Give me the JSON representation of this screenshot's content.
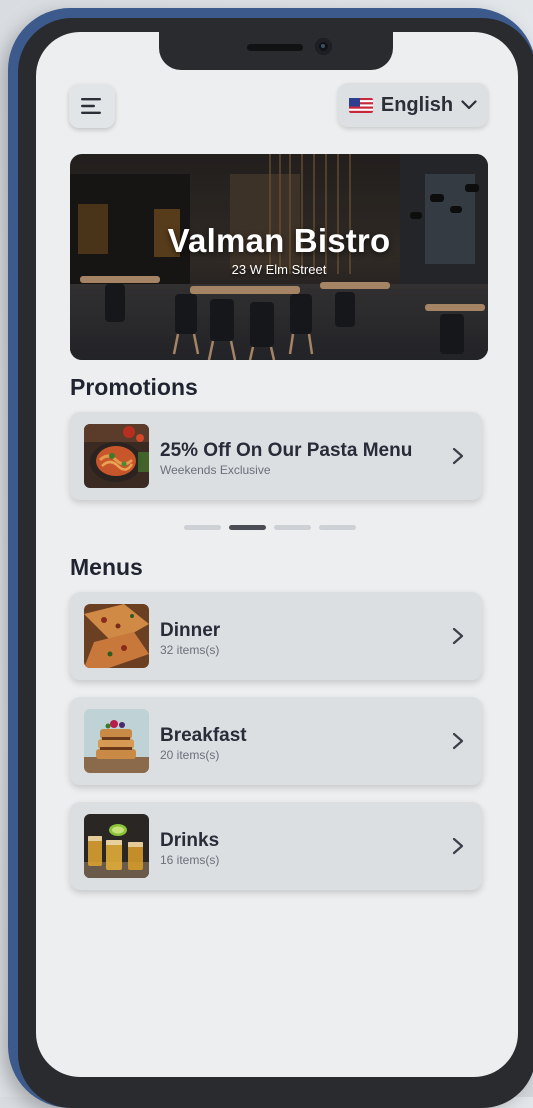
{
  "header": {
    "language_label": "English",
    "language_flag": "us-flag-icon"
  },
  "hero": {
    "restaurant_name": "Valman Bistro",
    "address": "23 W Elm Street"
  },
  "promotions": {
    "section_title": "Promotions",
    "items": [
      {
        "title": "25% Off On Our Pasta Menu",
        "subtitle": "Weekends Exclusive"
      }
    ],
    "carousel_active_index": 1,
    "carousel_count": 4
  },
  "menus": {
    "section_title": "Menus",
    "items": [
      {
        "title": "Dinner",
        "subtitle": "32 items(s)"
      },
      {
        "title": "Breakfast",
        "subtitle": "20 items(s)"
      },
      {
        "title": "Drinks",
        "subtitle": "16 items(s)"
      }
    ]
  },
  "colors": {
    "frame": "#3c5a8c",
    "screen_bg": "#eceeef",
    "card_bg": "#dcdfe2",
    "text_dark": "#272c38",
    "text_muted": "#6a707a",
    "carousel_active": "#4a4d53"
  }
}
